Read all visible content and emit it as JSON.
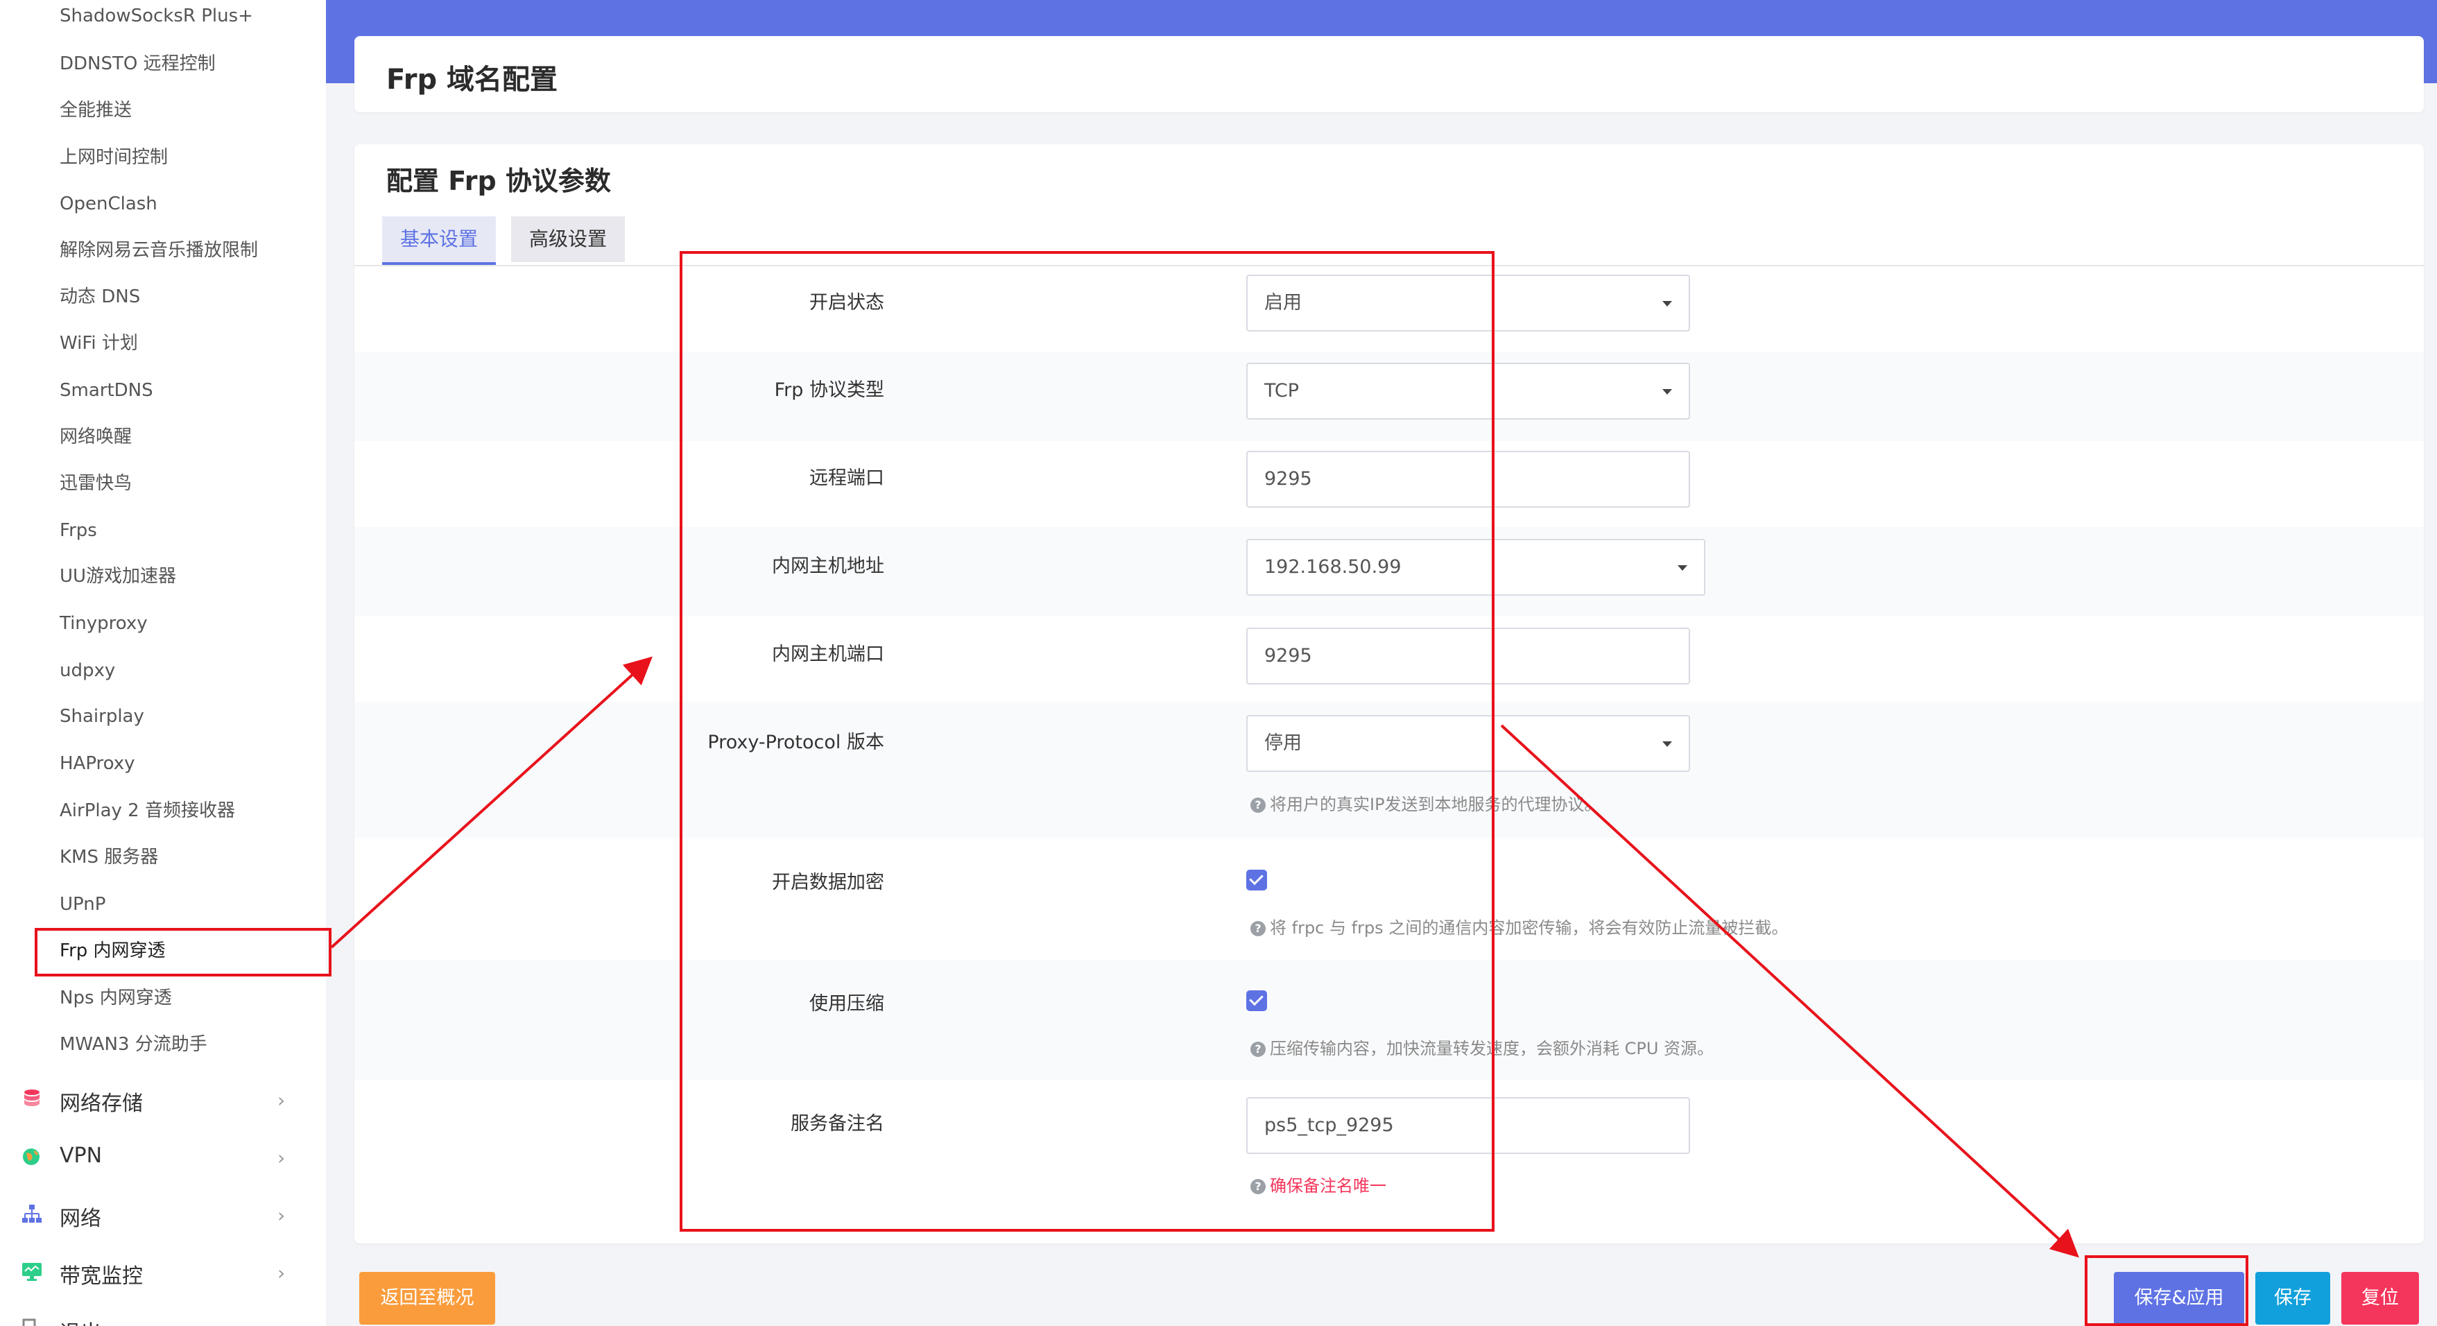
{
  "sidebar": {
    "items": [
      {
        "label": "ShadowSocksR Plus+"
      },
      {
        "label": "DDNSTO 远程控制"
      },
      {
        "label": "全能推送"
      },
      {
        "label": "上网时间控制"
      },
      {
        "label": "OpenClash"
      },
      {
        "label": "解除网易云音乐播放限制"
      },
      {
        "label": "动态 DNS"
      },
      {
        "label": "WiFi 计划"
      },
      {
        "label": "SmartDNS"
      },
      {
        "label": "网络唤醒"
      },
      {
        "label": "迅雷快鸟"
      },
      {
        "label": "Frps"
      },
      {
        "label": "UU游戏加速器"
      },
      {
        "label": "Tinyproxy"
      },
      {
        "label": "udpxy"
      },
      {
        "label": "Shairplay"
      },
      {
        "label": "HAProxy"
      },
      {
        "label": "AirPlay 2 音频接收器"
      },
      {
        "label": "KMS 服务器"
      },
      {
        "label": "UPnP"
      },
      {
        "label": "Frp 内网穿透"
      },
      {
        "label": "Nps 内网穿透"
      },
      {
        "label": "MWAN3 分流助手"
      }
    ],
    "groups": [
      {
        "label": "网络存储",
        "icon": "storage-icon",
        "color": "#f5365c"
      },
      {
        "label": "VPN",
        "icon": "globe-icon",
        "color": "#2dce89"
      },
      {
        "label": "网络",
        "icon": "network-icon",
        "color": "#5e72e4"
      },
      {
        "label": "带宽监控",
        "icon": "monitor-icon",
        "color": "#2dce89"
      },
      {
        "label": "退出",
        "icon": "logout-icon",
        "color": "#888888"
      }
    ]
  },
  "page": {
    "title": "Frp 域名配置",
    "section_heading": "配置 Frp 协议参数",
    "tabs": [
      {
        "label": "基本设置",
        "active": true
      },
      {
        "label": "高级设置",
        "active": false
      }
    ]
  },
  "form": {
    "enable_label": "开启状态",
    "enable_value": "启用",
    "protocol_label": "Frp 协议类型",
    "protocol_value": "TCP",
    "remote_port_label": "远程端口",
    "remote_port_value": "9295",
    "local_ip_label": "内网主机地址",
    "local_ip_value": "192.168.50.99",
    "local_port_label": "内网主机端口",
    "local_port_value": "9295",
    "proxy_protocol_label": "Proxy-Protocol 版本",
    "proxy_protocol_value": "停用",
    "proxy_protocol_hint": "将用户的真实IP发送到本地服务的代理协议。",
    "encryption_label": "开启数据加密",
    "encryption_checked": true,
    "encryption_hint": "将 frpc 与 frps 之间的通信内容加密传输，将会有效防止流量被拦截。",
    "compression_label": "使用压缩",
    "compression_checked": true,
    "compression_hint": "压缩传输内容，加快流量转发速度，会额外消耗 CPU 资源。",
    "remark_label": "服务备注名",
    "remark_value": "ps5_tcp_9295",
    "remark_hint": "确保备注名唯一"
  },
  "footer": {
    "back_label": "返回至概况",
    "save_apply_label": "保存&应用",
    "save_label": "保存",
    "reset_label": "复位"
  },
  "colors": {
    "accent": "#5e72e4",
    "danger": "#f5365c",
    "warning": "#fb9c3c",
    "info": "#11a0db",
    "annotation": "#e8121b"
  }
}
